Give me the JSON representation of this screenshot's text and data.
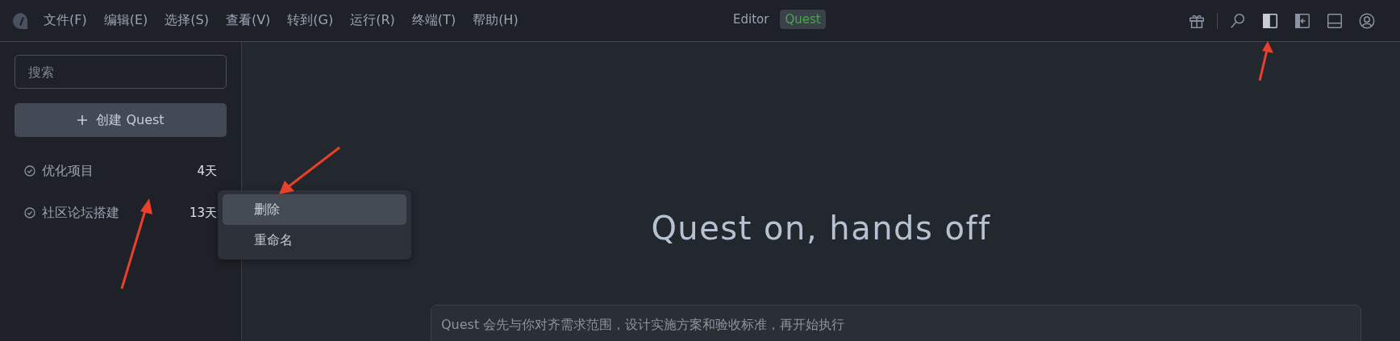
{
  "menu_bar": {
    "items": [
      "文件(F)",
      "编辑(E)",
      "选择(S)",
      "查看(V)",
      "转到(G)",
      "运行(R)",
      "终端(T)",
      "帮助(H)"
    ],
    "modes": [
      {
        "label": "Editor",
        "selected": false
      },
      {
        "label": "Quest",
        "selected": true
      }
    ],
    "toolbar_icons": [
      {
        "kind": "gift",
        "selected": false
      },
      {
        "kind": "search",
        "selected": false
      },
      {
        "kind": "sidebar",
        "selected": true
      },
      {
        "kind": "panel-right",
        "selected": false
      },
      {
        "kind": "panel-bottom",
        "selected": false
      },
      {
        "kind": "account",
        "selected": false
      }
    ]
  },
  "sidebar": {
    "search": {
      "placeholder": "搜索"
    },
    "create_button": "创建 Quest",
    "items": [
      {
        "title": "优化项目",
        "age": "4天"
      },
      {
        "title": "社区论坛搭建",
        "age": "13天"
      }
    ]
  },
  "context_menu": {
    "items": [
      {
        "label": "删除",
        "selected": true
      },
      {
        "label": "重命名",
        "selected": false
      }
    ]
  },
  "main": {
    "heading": "Quest on, hands off",
    "prompt": {
      "placeholder": "Quest 会先与你对齐需求范围，设计实施方案和验收标准，再开始执行"
    }
  }
}
